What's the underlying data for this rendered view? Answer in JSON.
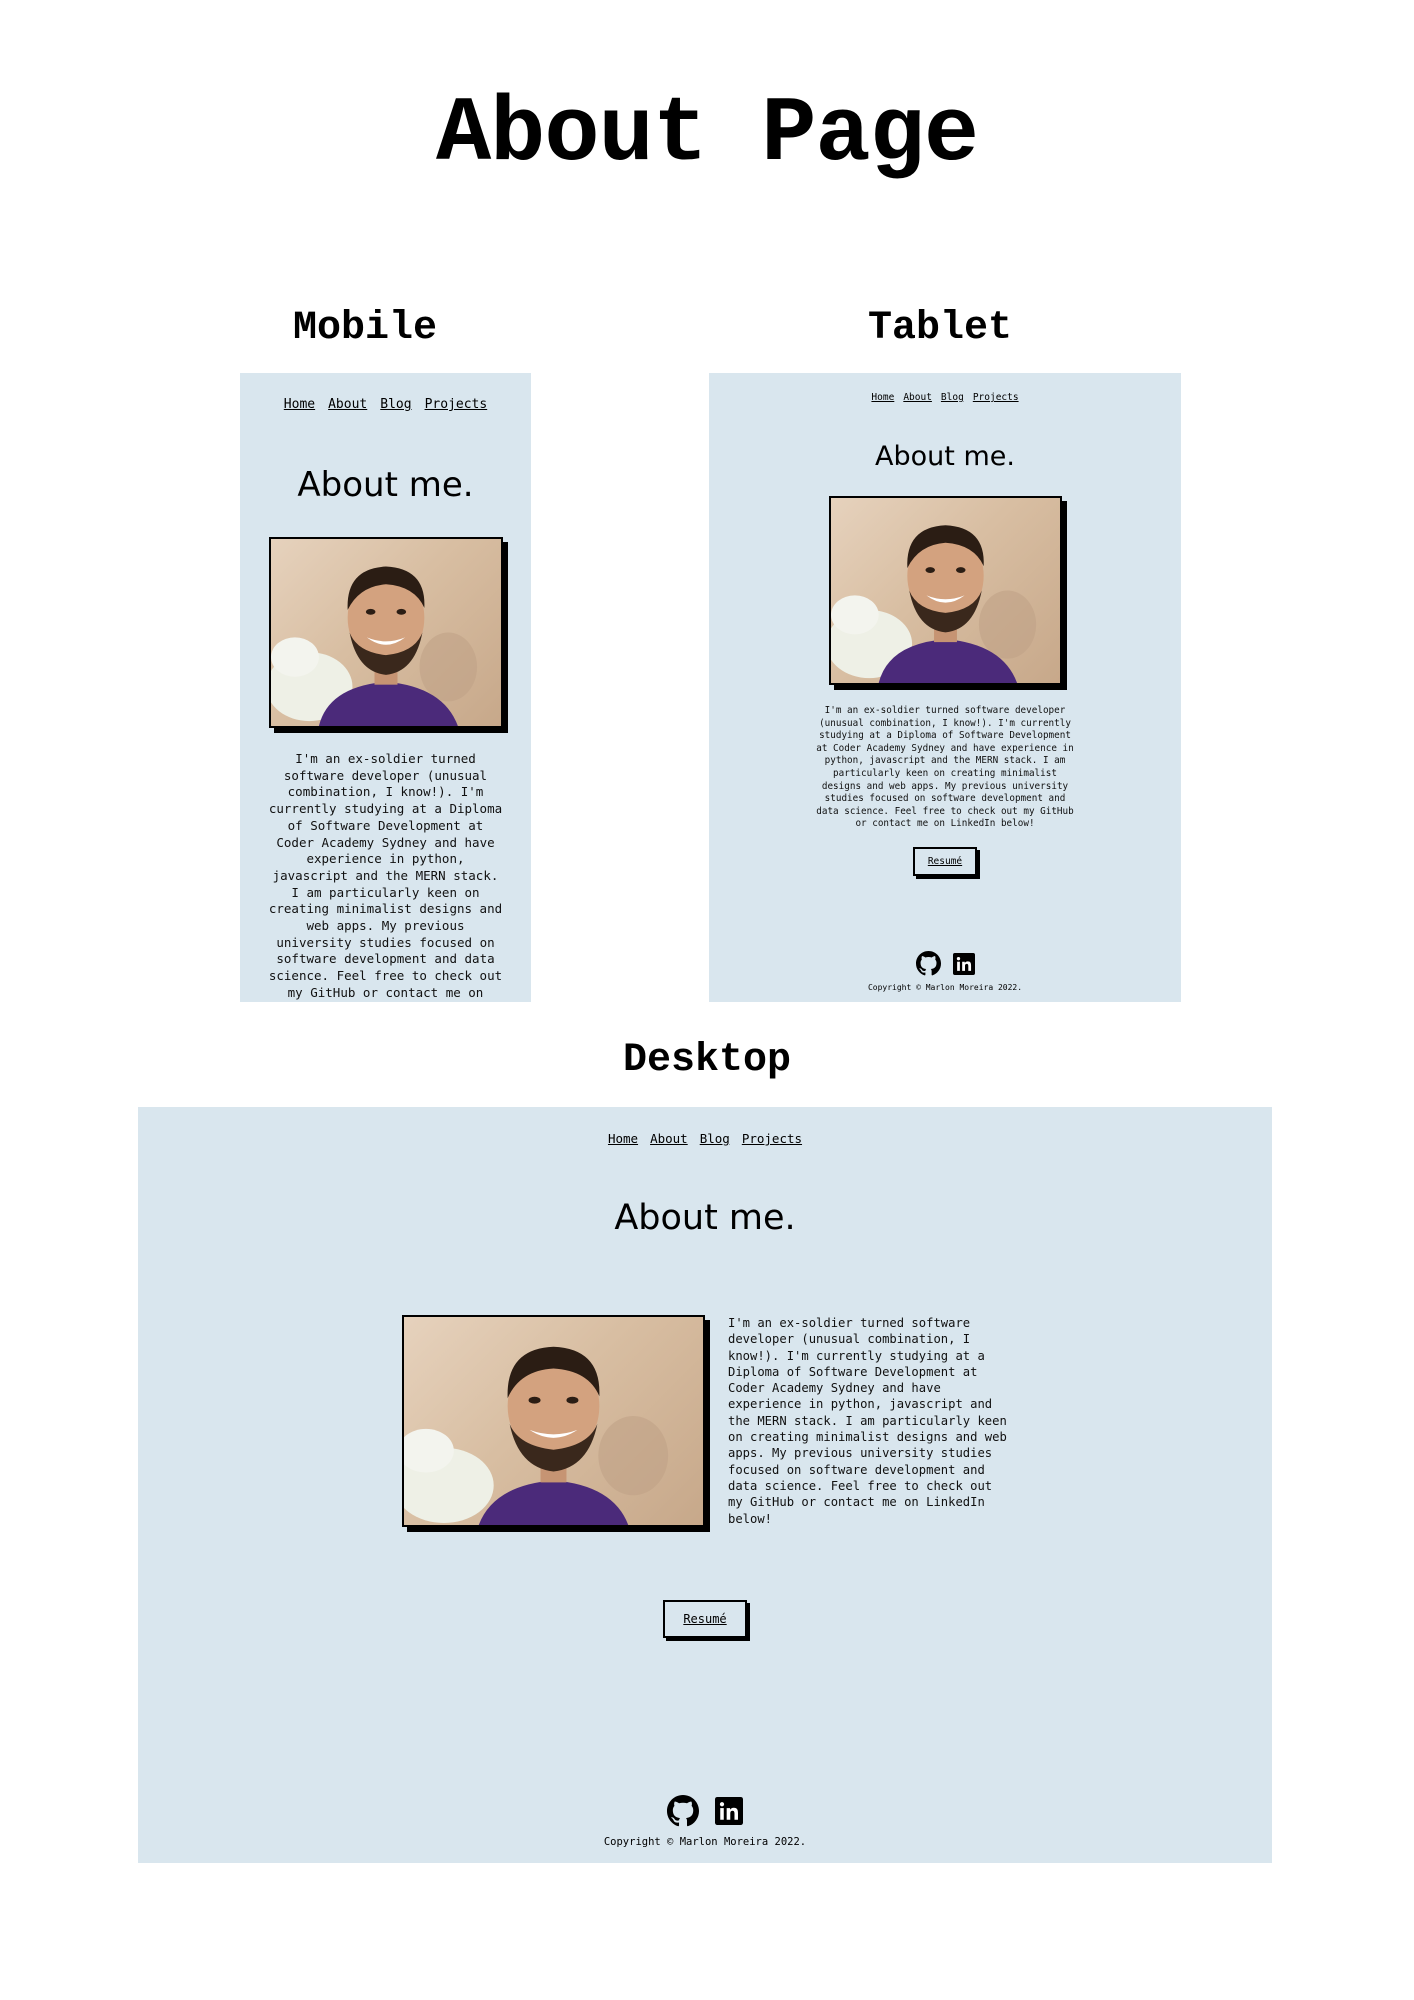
{
  "page_title": "About Page",
  "mobile": {
    "label": "Mobile",
    "nav": [
      "Home",
      "About",
      "Blog",
      "Projects"
    ],
    "heading": "About me.",
    "bio_lines": [
      "I'm an ex-soldier turned",
      "software developer (unusual",
      "combination, I know!). I'm",
      "currently studying at a Diploma",
      "of Software Development at",
      "Coder Academy Sydney and have",
      "experience in python,",
      "javascript and the MERN stack.",
      "I am particularly keen on",
      "creating minimalist designs and",
      "web apps. My previous",
      "university studies focused on",
      "software development and data",
      "science. Feel free to check out",
      "my GitHub or contact me on"
    ]
  },
  "tablet": {
    "label": "Tablet",
    "nav": [
      "Home",
      "About",
      "Blog",
      "Projects"
    ],
    "heading": "About me.",
    "bio_lines": [
      "I'm an ex-soldier turned software developer",
      "(unusual combination, I know!). I'm currently",
      "studying at a Diploma of Software Development",
      "at Coder Academy Sydney and have experience in",
      "python, javascript and the MERN stack. I am",
      "particularly keen on creating minimalist",
      "designs and web apps. My previous university",
      "studies focused on software development and",
      "data science. Feel free to check out my GitHub",
      "or contact me on LinkedIn below!"
    ],
    "resume_label": "Resumé",
    "copyright": "Copyright © Marlon Moreira 2022."
  },
  "desktop": {
    "label": "Desktop",
    "nav": [
      "Home",
      "About",
      "Blog",
      "Projects"
    ],
    "heading": "About me.",
    "bio_lines": [
      "I'm an ex-soldier turned software",
      "developer (unusual combination, I",
      "know!). I'm currently studying at a",
      "Diploma of Software Development at",
      "Coder Academy Sydney and have",
      "experience in python, javascript and",
      "the MERN stack. I am particularly keen",
      "on creating minimalist designs and web",
      "apps. My previous university studies",
      "focused on software development and",
      "data science. Feel free to check out",
      "my GitHub or contact me on LinkedIn",
      "below!"
    ],
    "resume_label": "Resumé",
    "copyright": "Copyright © Marlon Moreira 2022."
  },
  "colors": {
    "frame_bg": "#d9e6ee",
    "shirt": "#4b2a7a"
  },
  "icons": [
    "github-icon",
    "linkedin-icon"
  ]
}
